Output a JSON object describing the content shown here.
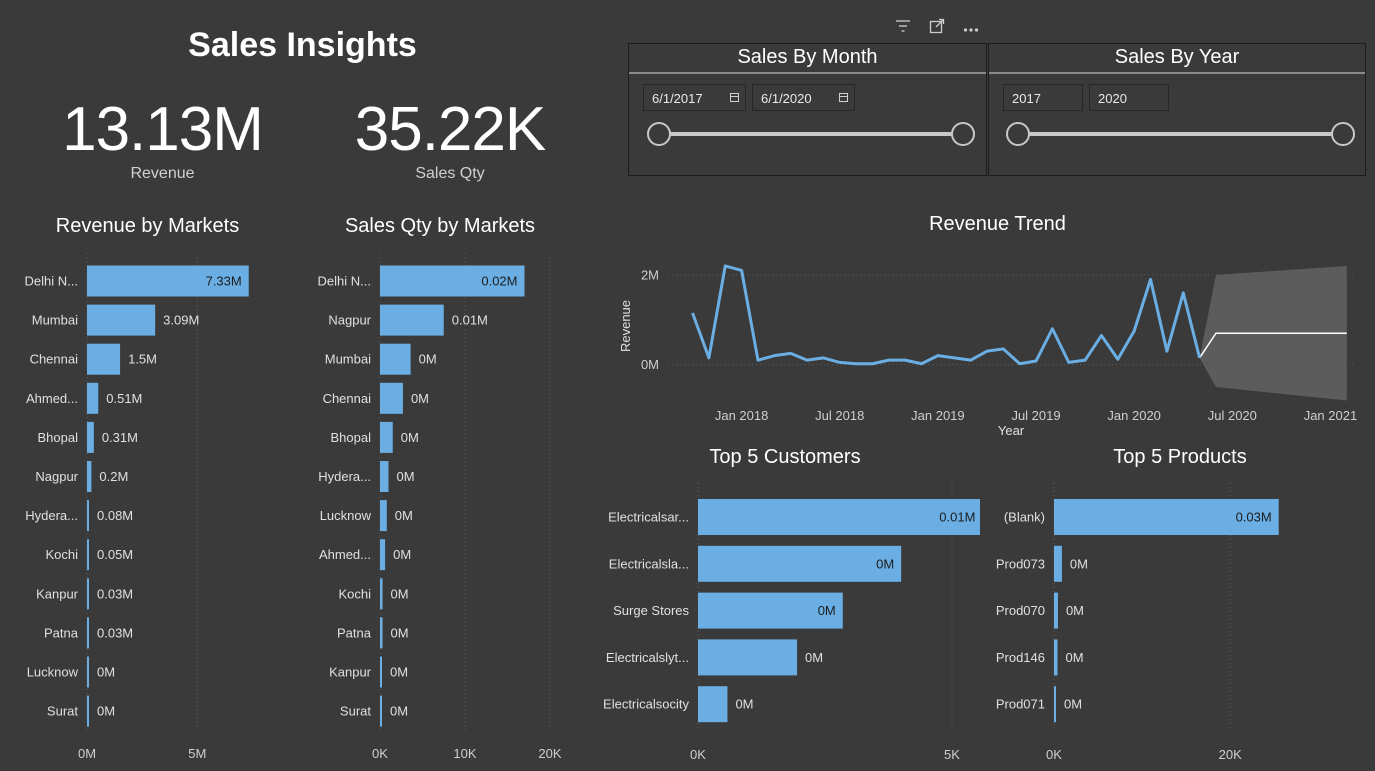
{
  "header": {
    "title": "Sales Insights"
  },
  "kpis": [
    {
      "value": "13.13M",
      "label": "Revenue"
    },
    {
      "value": "35.22K",
      "label": "Sales Qty"
    }
  ],
  "toolbar": {
    "icons": [
      "filter-icon",
      "focus-mode-icon",
      "more-options-icon"
    ]
  },
  "slicer_month": {
    "title": "Sales By Month",
    "start": "6/1/2017",
    "end": "6/1/2020",
    "range_fraction": [
      0.0,
      1.0
    ]
  },
  "slicer_year": {
    "title": "Sales By Year",
    "start": "2017",
    "end": "2020",
    "range_fraction": [
      0.0,
      1.0
    ]
  },
  "colors": {
    "bar": "#6aaee3",
    "background": "#3a3a3a",
    "line": "#6aaee3",
    "forecast_band": "#5e5e5e",
    "forecast_line": "#ffffff"
  },
  "chart_data": [
    {
      "id": "revenue_by_markets",
      "type": "bar",
      "orientation": "horizontal",
      "title": "Revenue by Markets",
      "categories": [
        "Delhi N...",
        "Mumbai",
        "Chennai",
        "Ahmed...",
        "Bhopal",
        "Nagpur",
        "Hydera...",
        "Kochi",
        "Kanpur",
        "Patna",
        "Lucknow",
        "Surat"
      ],
      "values": [
        7.33,
        3.09,
        1.5,
        0.51,
        0.31,
        0.2,
        0.08,
        0.05,
        0.03,
        0.03,
        0.0,
        0.0
      ],
      "labels": [
        "7.33M",
        "3.09M",
        "1.5M",
        "0.51M",
        "0.31M",
        "0.2M",
        "0.08M",
        "0.05M",
        "0.03M",
        "0.03M",
        "0M",
        "0M"
      ],
      "xticks": [
        "0M",
        "5M"
      ],
      "xtick_values": [
        0,
        5
      ],
      "xlim": [
        0,
        9.2
      ]
    },
    {
      "id": "sales_qty_by_markets",
      "type": "bar",
      "orientation": "horizontal",
      "title": "Sales Qty by Markets",
      "categories": [
        "Delhi N...",
        "Nagpur",
        "Mumbai",
        "Chennai",
        "Bhopal",
        "Hydera...",
        "Lucknow",
        "Ahmed...",
        "Kochi",
        "Patna",
        "Kanpur",
        "Surat"
      ],
      "values": [
        17000,
        7500,
        3600,
        2700,
        1500,
        1000,
        800,
        600,
        300,
        300,
        200,
        200
      ],
      "labels": [
        "0.02M",
        "0.01M",
        "0M",
        "0M",
        "0M",
        "0M",
        "0M",
        "0M",
        "0M",
        "0M",
        "0M",
        "0M"
      ],
      "xticks": [
        "0K",
        "10K",
        "20K"
      ],
      "xtick_values": [
        0,
        10000,
        20000
      ],
      "xlim": [
        0,
        20000
      ]
    },
    {
      "id": "revenue_trend",
      "type": "line",
      "title": "Revenue Trend",
      "xlabel": "Year",
      "ylabel": "Revenue",
      "yticks": [
        "0M",
        "2M"
      ],
      "ytick_values": [
        0,
        2
      ],
      "ylim": [
        -0.9,
        2.6
      ],
      "xticks": [
        "Jan 2018",
        "Jul 2018",
        "Jan 2019",
        "Jul 2019",
        "Jan 2020",
        "Jul 2020",
        "Jan 2021"
      ],
      "xtick_values": [
        0,
        6,
        12,
        18,
        24,
        30,
        36
      ],
      "xlim": [
        -4.5,
        37.5
      ],
      "x": [
        -3,
        -2,
        -1,
        0,
        1,
        2,
        3,
        4,
        5,
        6,
        7,
        8,
        9,
        10,
        11,
        12,
        13,
        14,
        15,
        16,
        17,
        18,
        19,
        20,
        21,
        22,
        23,
        24,
        25,
        26,
        27
      ],
      "values": [
        1.15,
        0.15,
        2.2,
        2.1,
        0.1,
        0.2,
        0.25,
        0.1,
        0.15,
        0.05,
        0.02,
        0.02,
        0.1,
        0.1,
        0.02,
        0.2,
        0.15,
        0.1,
        0.3,
        0.35,
        0.02,
        0.08,
        0.8,
        0.05,
        0.1,
        0.65,
        0.12,
        0.75,
        1.9,
        0.3,
        1.6
      ],
      "forecast": {
        "x": [
          28,
          29,
          37
        ],
        "values": [
          0.15,
          0.7,
          0.7
        ],
        "upper": [
          0.15,
          2.0,
          2.2
        ],
        "lower": [
          0.15,
          -0.5,
          -0.8
        ]
      }
    },
    {
      "id": "top5_customers",
      "type": "bar",
      "orientation": "horizontal",
      "title": "Top 5 Customers",
      "categories": [
        "Electricalsar...",
        "Electricalsla...",
        "Surge Stores",
        "Electricalslyt...",
        "Electricalsocity"
      ],
      "values": [
        5600,
        4000,
        2850,
        1950,
        580
      ],
      "labels": [
        "0.01M",
        "0M",
        "0M",
        "0M",
        "0M"
      ],
      "xticks": [
        "0K",
        "5K"
      ],
      "xtick_values": [
        0,
        5000
      ],
      "xlim": [
        0,
        6950
      ]
    },
    {
      "id": "top5_products",
      "type": "bar",
      "orientation": "horizontal",
      "title": "Top 5 Products",
      "categories": [
        "(Blank)",
        "Prod073",
        "Prod070",
        "Prod146",
        "Prod071"
      ],
      "values": [
        25500,
        900,
        450,
        400,
        200
      ],
      "labels": [
        "0.03M",
        "0M",
        "0M",
        "0M",
        "0M"
      ],
      "xticks": [
        "0K",
        "20K"
      ],
      "xtick_values": [
        0,
        20000
      ],
      "xlim": [
        0,
        32000
      ]
    }
  ]
}
